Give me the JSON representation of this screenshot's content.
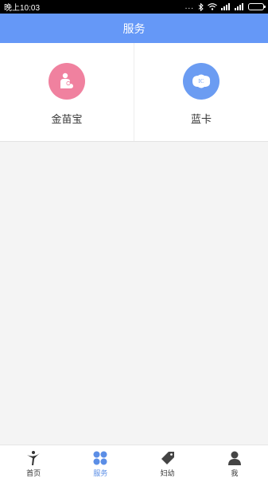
{
  "status_bar": {
    "time": "晚上10:03",
    "dots": "..."
  },
  "header": {
    "title": "服务"
  },
  "services": [
    {
      "label": "金苗宝",
      "icon": "mother-baby-icon",
      "color": "#f0819f"
    },
    {
      "label": "蓝卡",
      "icon": "ic-card-icon",
      "icon_text": "IC",
      "color": "#6b9cf2"
    }
  ],
  "tabs": [
    {
      "label": "首页",
      "icon": "home-figure-icon",
      "active": false
    },
    {
      "label": "服务",
      "icon": "services-icon",
      "active": true
    },
    {
      "label": "妇幼",
      "icon": "tag-icon",
      "active": false
    },
    {
      "label": "我",
      "icon": "user-icon",
      "active": false
    }
  ],
  "colors": {
    "header": "#6598f7",
    "active_tab": "#5b8ee6",
    "background": "#f4f4f4"
  }
}
